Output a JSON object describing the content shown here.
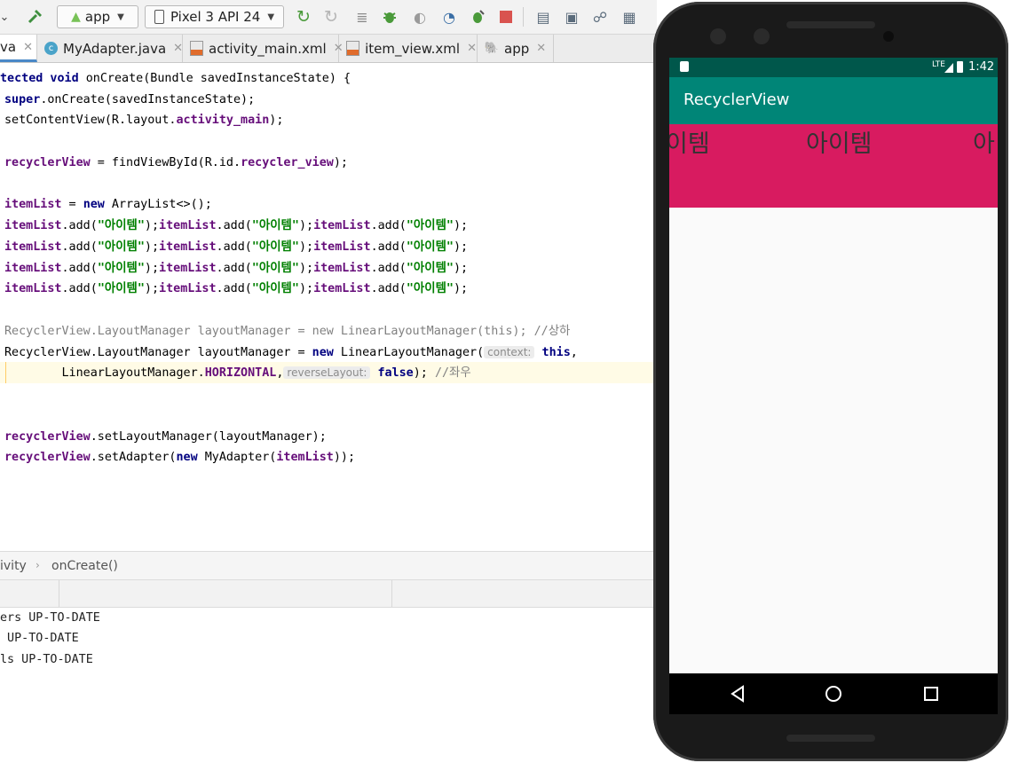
{
  "toolbar": {
    "module_combo": "app",
    "device_combo": "Pixel 3 API 24"
  },
  "tabs": [
    {
      "label": "va",
      "active": true
    },
    {
      "label": "MyAdapter.java"
    },
    {
      "label": "activity_main.xml"
    },
    {
      "label": "item_view.xml"
    },
    {
      "label": "app"
    }
  ],
  "code": {
    "l1_kw": "tected void",
    "l1_rest": " onCreate(Bundle savedInstanceState) {",
    "l2_kw": "super",
    "l2_rest": ".onCreate(savedInstanceState);",
    "l3_a": "setContentView(R.layout.",
    "l3_f": "activity_main",
    "l3_b": ");",
    "l4_f": "recyclerView",
    "l4_a": " = findViewById(R.id.",
    "l4_f2": "recycler_view",
    "l4_b": ");",
    "l5_f": "itemList",
    "l5_a": " = ",
    "l5_kw": "new",
    "l5_b": " ArrayList<>();",
    "add_f": "itemList",
    "add_a": ".add(",
    "add_str": "\"아이템\"",
    "add_b": ");",
    "add_end": ");",
    "cm_line": "RecyclerView.LayoutManager layoutManager = new LinearLayoutManager(this); //상하",
    "lm_a": "RecyclerView.LayoutManager layoutManager = ",
    "lm_kw": "new",
    "lm_b": " LinearLayoutManager(",
    "lm_hint": "context:",
    "lm_kw2": "this",
    "lm_c": ",",
    "ori_a": "        LinearLayoutManager.",
    "ori_f": "HORIZONTAL",
    "ori_b": ",",
    "ori_hint": "reverseLayout:",
    "ori_kw": "false",
    "ori_c": "); ",
    "ori_cm": "//좌우",
    "set1_f": "recyclerView",
    "set1_a": ".setLayoutManager(layoutManager);",
    "set2_f": "recyclerView",
    "set2_a": ".setAdapter(",
    "set2_kw": "new",
    "set2_b": " MyAdapter(",
    "set2_f2": "itemList",
    "set2_c": "));"
  },
  "breadcrumb": {
    "first": "ivity",
    "second": "onCreate()"
  },
  "output": [
    "ers UP-TO-DATE",
    " UP-TO-DATE",
    "ls UP-TO-DATE"
  ],
  "phone": {
    "time": "1:42",
    "network": "LTE",
    "app_title": "RecyclerView",
    "items": [
      "이템",
      "아이템",
      "아"
    ],
    "colors": {
      "status": "#00574b",
      "appbar": "#008577",
      "item_bg": "#d81b60"
    }
  }
}
